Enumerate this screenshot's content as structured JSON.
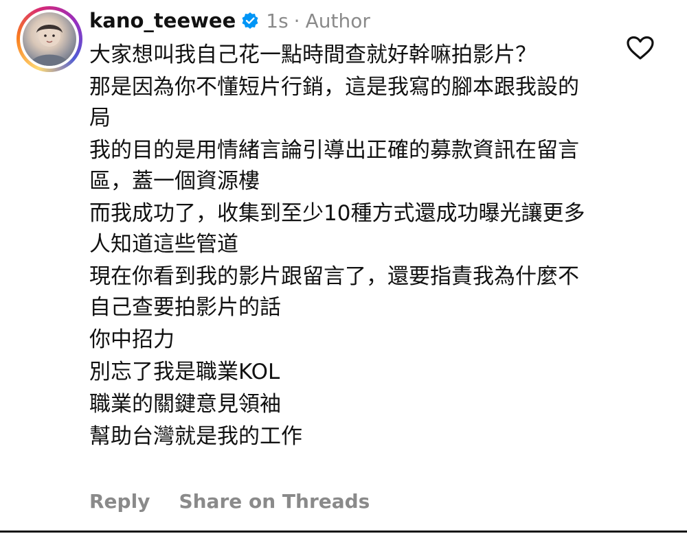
{
  "comment": {
    "username": "kano_teewee",
    "time": "1s",
    "separator": "·",
    "role": "Author",
    "paragraphs": [
      "大家想叫我自己花一點時間查就好幹嘛拍影片？",
      "那是因為你不懂短片行銷，這是我寫的腳本跟我設的局",
      "我的目的是用情緒言論引導出正確的募款資訊在留言區，蓋一個資源樓",
      "而我成功了，收集到至少10種方式還成功曝光讓更多人知道這些管道",
      "現在你看到我的影片跟留言了，還要指責我為什麼不自己查要拍影片的話",
      "你中招力",
      "別忘了我是職業KOL",
      "職業的關鍵意見領袖",
      "幫助台灣就是我的工作"
    ]
  },
  "actions": {
    "reply": "Reply",
    "share": "Share on Threads"
  },
  "icons": {
    "verified": "verified-badge-icon",
    "like": "heart-outline-icon"
  },
  "colors": {
    "verified_blue": "#0095f6",
    "meta_gray": "#8a8a8a",
    "text": "#111111"
  }
}
